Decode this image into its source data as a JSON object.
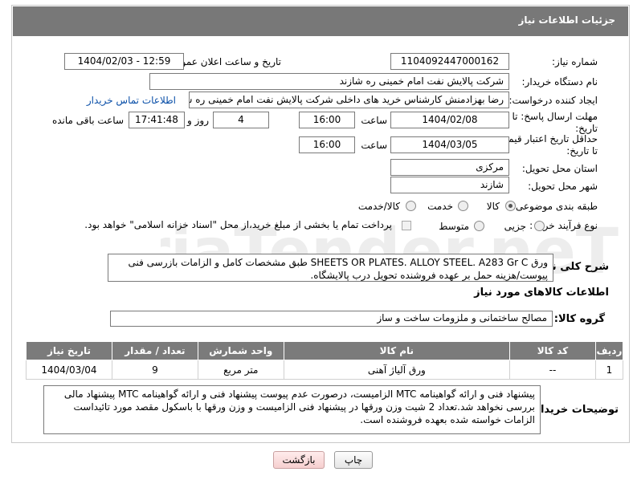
{
  "header": {
    "title": "جزئیات اطلاعات نیاز"
  },
  "fields": {
    "need_number_label": "شماره نیاز:",
    "need_number": "1104092447000162",
    "announce_label": "تاریخ و ساعت اعلان عمومی:",
    "announce_value": "1404/02/03 - 12:59",
    "buyer_label": "نام دستگاه خریدار:",
    "buyer_value": "شرکت پالایش نفت امام خمینی  ره  شازند",
    "creator_label": "ایجاد کننده درخواست:",
    "creator_value": "رضا بهزادمنش کارشناس خرید های داخلی  شرکت پالایش نفت امام خمینی  ره  شازند",
    "contact_link": "اطلاعات تماس خریدار",
    "deadline_label": "مهلت ارسال پاسخ: تا تاریخ:",
    "deadline_date": "1404/02/08",
    "time_label": "ساعت",
    "deadline_time": "16:00",
    "days_value": "4",
    "days_label": "روز و",
    "remaining_time": "17:41:48",
    "remaining_label": "ساعت باقی مانده",
    "validity_label": "حداقل تاریخ اعتبار قیمت: تا تاریخ:",
    "validity_date": "1404/03/05",
    "validity_time": "16:00",
    "province_label": "استان محل تحویل:",
    "province_value": "مرکزی",
    "city_label": "شهر محل تحویل:",
    "city_value": "شازند",
    "category_label": "طبقه بندی موضوعی:",
    "category_options": [
      "کالا",
      "خدمت",
      "کالا/خدمت"
    ],
    "category_selected": "کالا",
    "process_label": "نوع فرآیند خرید :",
    "process_options": [
      "جزیی",
      "متوسط"
    ],
    "process_selected": "جزیی",
    "payment_note": "پرداخت تمام یا بخشی از مبلغ خرید،از محل \"اسناد خزانه اسلامی\" خواهد بود."
  },
  "summary": {
    "label": "شرح کلی نیاز:",
    "text": "ورق SHEETS OR PLATES. ALLOY STEEL. A283 Gr C  طبق مشخصات کامل و الزامات بازرسی فنی پیوست/هزینه حمل بر عهده فروشنده تحویل درب پالایشگاه."
  },
  "goods_section": {
    "title": "اطلاعات کالاهای مورد نیاز",
    "group_label": "گروه کالا:",
    "group_value": "مصالح ساختمانی و ملزومات ساخت و ساز"
  },
  "table": {
    "headers": [
      "ردیف",
      "کد کالا",
      "نام کالا",
      "واحد شمارش",
      "تعداد / مقدار",
      "تاریخ نیاز"
    ],
    "rows": [
      [
        "1",
        "--",
        "ورق آلیاژ آهنی",
        "متر مربع",
        "9",
        "1404/03/04"
      ]
    ]
  },
  "buyer_notes": {
    "label": "توضیحات خریدار:",
    "text": "پیشنهاد فنی و ارائه گواهینامه MTC الزامیست، درصورت عدم پیوست پیشنهاد فنی و ارائه گواهینامه MTC پیشنهاد مالی بررسی نخواهد شد.تعداد 2 شیت وزن ورقها در پیشنهاد فنی الزامیست و وزن ورقها با باسکول مقصد مورد تائیداست الزامات خواسته شده بعهده فروشنده است."
  },
  "buttons": {
    "print": "چاپ",
    "back": "بازگشت"
  },
  "watermark": {
    "text": "AriaTender.neT"
  }
}
